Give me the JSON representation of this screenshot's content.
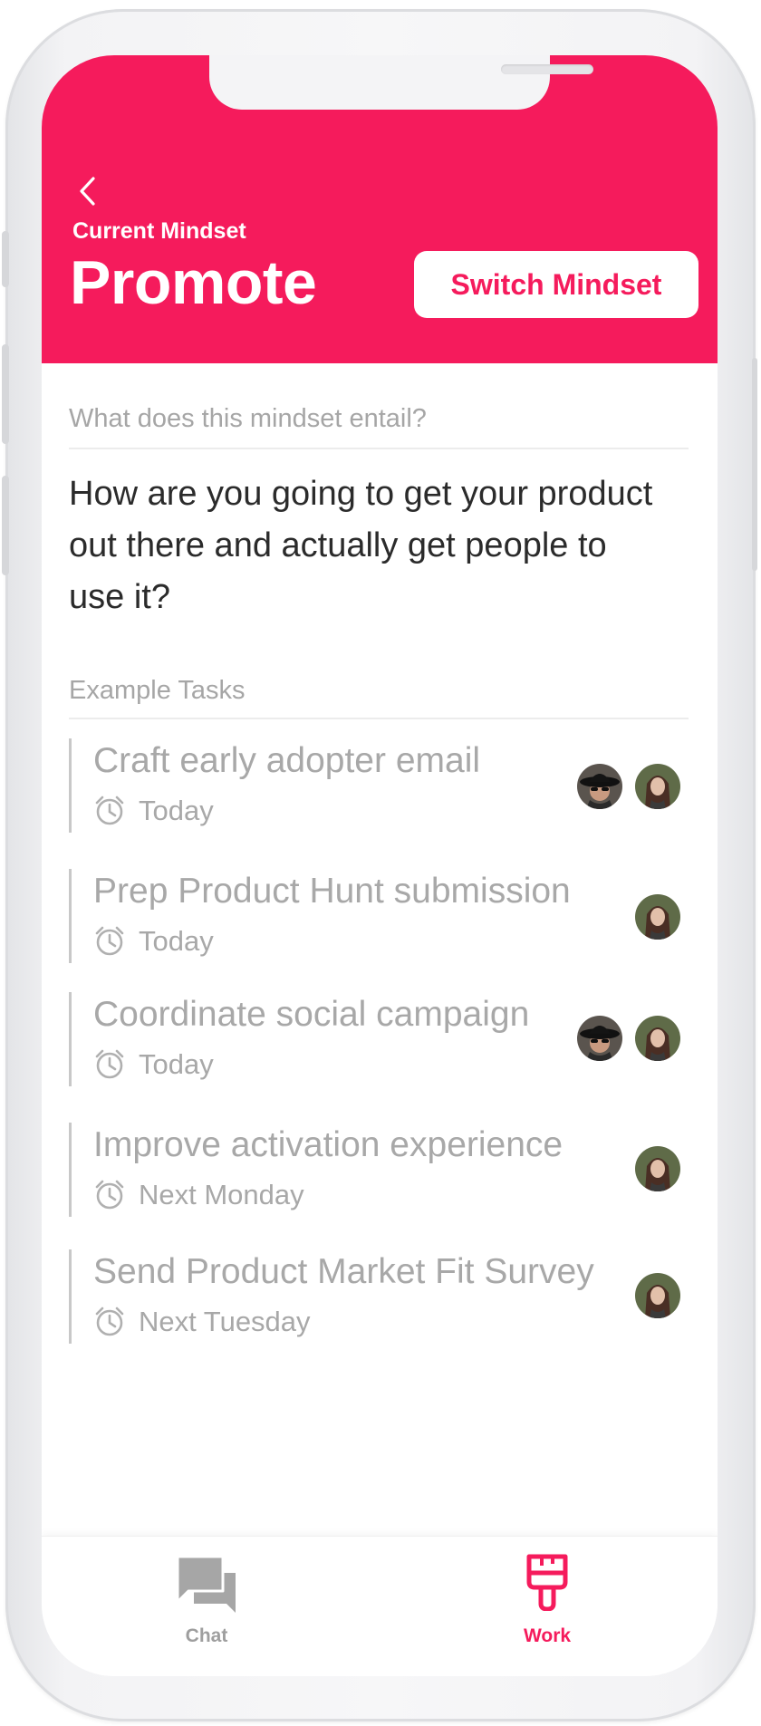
{
  "header": {
    "back_icon": "chevron-left-icon",
    "current_label": "Current Mindset",
    "mindset_name": "Promote",
    "switch_button": "Switch Mindset"
  },
  "mindset": {
    "question": "What does this mindset entail?",
    "description": "How are you going to get your product out there and actually get people to use it?"
  },
  "tasks_section": {
    "label": "Example Tasks",
    "tasks": [
      {
        "title": "Craft early adopter email",
        "due": "Today",
        "assignees": [
          "woman-hat-sunglasses-avatar",
          "woman-long-hair-avatar"
        ]
      },
      {
        "title": "Prep Product Hunt submission",
        "due": "Today",
        "assignees": [
          "woman-long-hair-avatar"
        ]
      },
      {
        "title": "Coordinate social campaign",
        "due": "Today",
        "assignees": [
          "woman-hat-sunglasses-avatar",
          "woman-long-hair-avatar"
        ]
      },
      {
        "title": "Improve activation experience",
        "due": "Next Monday",
        "assignees": [
          "woman-long-hair-avatar"
        ]
      },
      {
        "title": "Send Product Market Fit Survey",
        "due": "Next Tuesday",
        "assignees": [
          "woman-long-hair-avatar"
        ]
      }
    ]
  },
  "bottom_nav": {
    "items": [
      {
        "label": "Chat",
        "icon": "chat-bubbles-icon",
        "active": false
      },
      {
        "label": "Work",
        "icon": "paint-brush-icon",
        "active": true
      }
    ]
  },
  "colors": {
    "accent": "#f51b5c",
    "muted_text": "#a8a8a8",
    "inactive_nav": "#9e9e9e"
  }
}
